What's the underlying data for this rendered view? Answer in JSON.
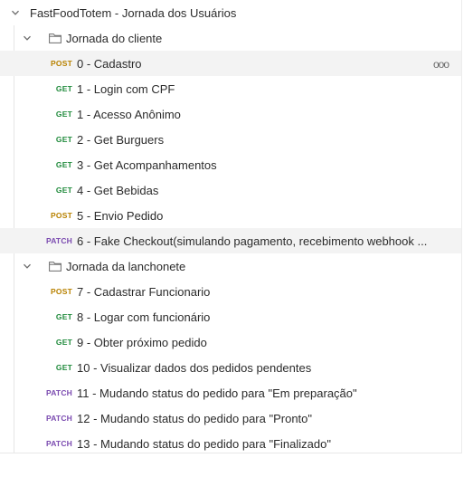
{
  "collection": {
    "title": "FastFoodTotem - Jornada dos Usuários",
    "folders": [
      {
        "name": "Jornada do cliente",
        "requests": [
          {
            "method": "POST",
            "name": "0 - Cadastro"
          },
          {
            "method": "GET",
            "name": "1 - Login com CPF"
          },
          {
            "method": "GET",
            "name": "1 - Acesso Anônimo"
          },
          {
            "method": "GET",
            "name": "2 - Get Burguers"
          },
          {
            "method": "GET",
            "name": "3 - Get Acompanhamentos"
          },
          {
            "method": "GET",
            "name": "4 - Get Bebidas"
          },
          {
            "method": "POST",
            "name": "5 - Envio Pedido"
          },
          {
            "method": "PATCH",
            "name": "6 - Fake Checkout(simulando pagamento, recebimento webhook ..."
          }
        ]
      },
      {
        "name": "Jornada da lanchonete",
        "requests": [
          {
            "method": "POST",
            "name": "7 - Cadastrar Funcionario"
          },
          {
            "method": "GET",
            "name": "8 - Logar com funcionário"
          },
          {
            "method": "GET",
            "name": "9 - Obter próximo pedido"
          },
          {
            "method": "GET",
            "name": "10 - Visualizar dados dos pedidos pendentes"
          },
          {
            "method": "PATCH",
            "name": "11 - Mudando status do pedido para \"Em preparação\""
          },
          {
            "method": "PATCH",
            "name": "12 - Mudando status do pedido para \"Pronto\""
          },
          {
            "method": "PATCH",
            "name": "13 - Mudando status do pedido para \"Finalizado\""
          }
        ]
      }
    ],
    "more_label": "ooo"
  },
  "colors": {
    "GET": "#1f8a3b",
    "POST": "#b88200",
    "PATCH": "#7b4bb0"
  },
  "icons": {
    "expand": "chevron-down-icon",
    "folder": "folder-icon",
    "more": "more-options-icon"
  }
}
